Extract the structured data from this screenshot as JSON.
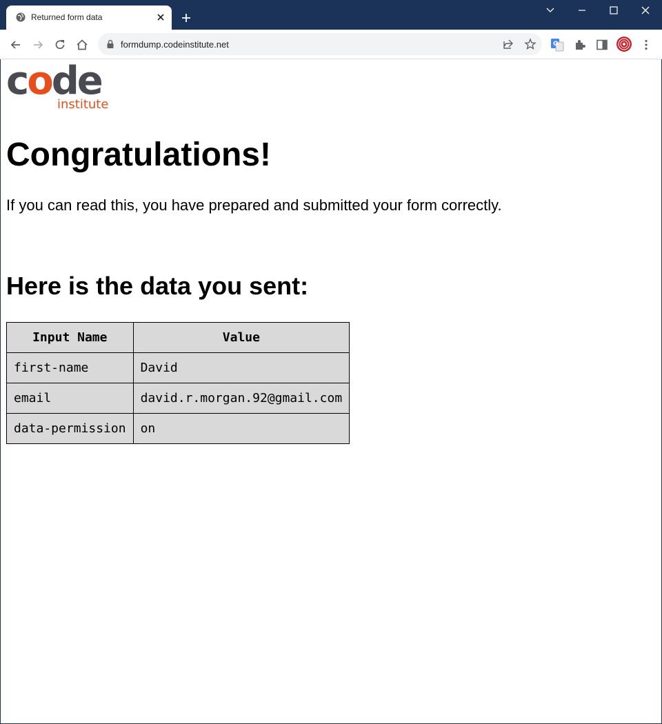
{
  "browser": {
    "tab_title": "Returned form data",
    "url": "formdump.codeinstitute.net"
  },
  "colors": {
    "frame": "#1b3358",
    "brand_orange": "#e84e1c",
    "brand_gray": "#4a4a52",
    "table_bg": "#d9d9d9"
  },
  "logo": {
    "word": "code",
    "sub": "institute"
  },
  "page": {
    "heading": "Congratulations!",
    "lead": "If you can read this, you have prepared and submitted your form correctly.",
    "subheading": "Here is the data you sent:"
  },
  "table": {
    "headers": [
      "Input Name",
      "Value"
    ],
    "rows": [
      [
        "first-name",
        "David"
      ],
      [
        "email",
        "david.r.morgan.92@gmail.com"
      ],
      [
        "data-permission",
        "on"
      ]
    ]
  }
}
